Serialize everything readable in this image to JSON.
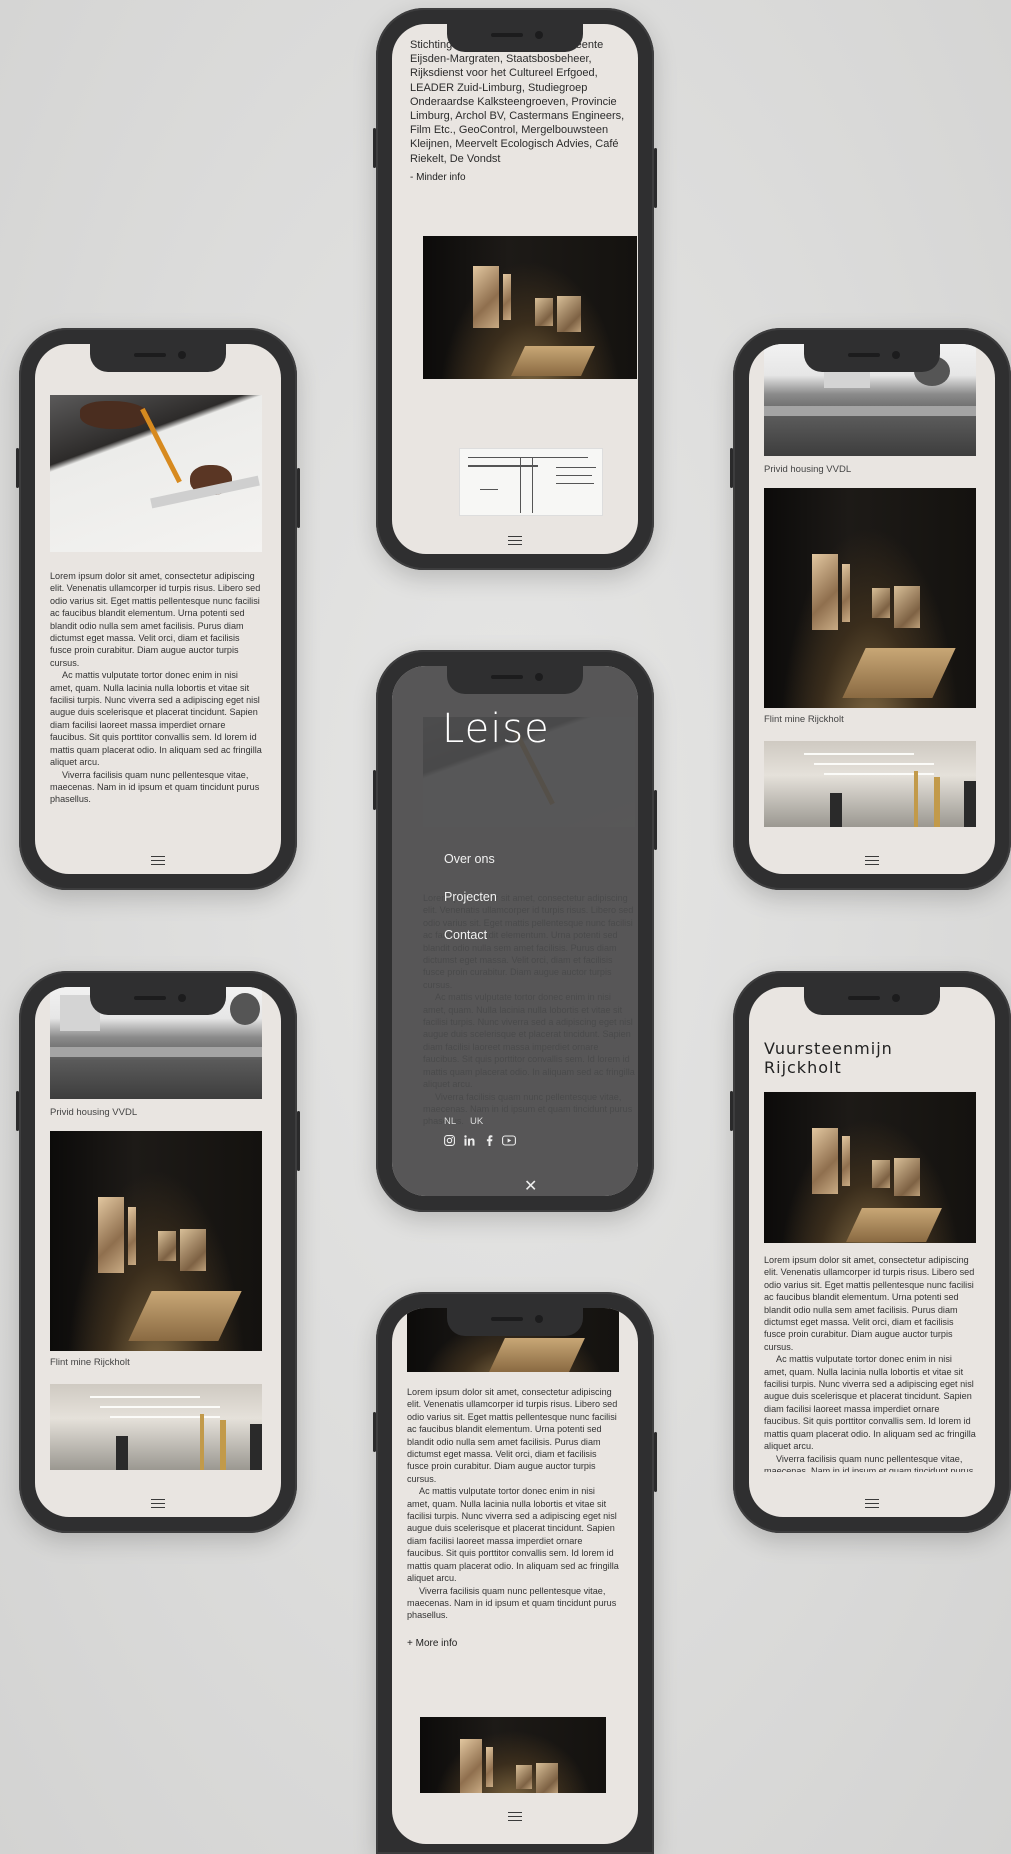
{
  "colors": {
    "background": "#dcdcdb",
    "phone_body": "#2f2f30",
    "screen": "#e9e5e1",
    "menu_overlay": "#4b4b4c"
  },
  "icons": {
    "menu": "hamburger-icon",
    "close": "close-icon",
    "social": [
      "instagram-icon",
      "linkedin-icon",
      "facebook-icon",
      "youtube-icon"
    ]
  },
  "lorem": {
    "p1": "Lorem ipsum dolor sit amet, consectetur adipiscing elit. Venenatis ullamcorper id turpis risus. Libero sed odio varius sit. Eget mattis pellentesque nunc facilisi ac faucibus blandit elementum. Urna potenti sed blandit odio nulla sem amet facilisis. Purus diam dictumst eget massa. Velit orci, diam et facilisis fusce proin curabitur. Diam augue auctor turpis cursus.",
    "p2": "Ac mattis vulputate tortor donec enim in nisi amet, quam. Nulla lacinia nulla lobortis et vitae sit facilisi turpis. Nunc viverra sed a adipiscing eget nisl augue duis scelerisque et placerat tincidunt. Sapien diam facilisi laoreet massa imperdiet ornare faucibus. Sit quis porttitor convallis sem. Id lorem id mattis quam placerat odio. In aliquam sed ac fringilla aliquet arcu.",
    "p3": "Viverra facilisis quam nunc pellentesque vitae, maecenas. Nam in id ipsum et quam tincidunt purus phasellus."
  },
  "phone_top": {
    "credits": "Stichting ir. D.C. van Schaik, Gemeente Eijsden-Margraten, Staatsbosbeheer, Rijksdienst voor het Cultureel Erfgoed, LEADER Zuid-Limburg, Studiegroep Onderaardse Kalksteengroeven, Provincie Limburg, Archol BV, Castermans Engineers, Film Etc., GeoControl, Mergelbouwsteen Kleijnen, Meervelt Ecologisch Advies, Café Riekelt, De Vondst",
    "less_info": "- Minder info"
  },
  "phone_menu": {
    "logo": "Leise",
    "nav": [
      "Over ons",
      "Projecten",
      "Contact"
    ],
    "languages": [
      "NL",
      "UK"
    ]
  },
  "projects": {
    "captions": [
      "Privid housing VVDL",
      "Flint mine Rijckholt"
    ]
  },
  "phone_detail": {
    "title_line1": "Vuursteenmijn",
    "title_line2": "Rijckholt"
  },
  "phone_bottom": {
    "more_info": "+ More info"
  }
}
